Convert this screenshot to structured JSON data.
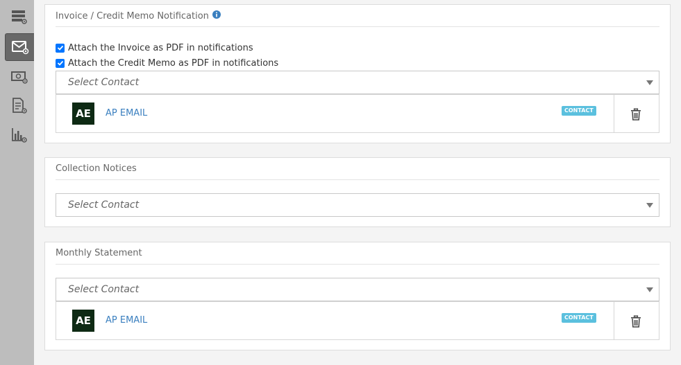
{
  "sidebar": {
    "items": [
      {
        "icon": "server-settings-icon",
        "active": false
      },
      {
        "icon": "envelope-settings-icon",
        "active": true
      },
      {
        "icon": "money-settings-icon",
        "active": false
      },
      {
        "icon": "document-settings-icon",
        "active": false
      },
      {
        "icon": "chart-settings-icon",
        "active": false
      }
    ]
  },
  "invoice_section": {
    "title": "Invoice / Credit Memo Notification",
    "checkbox_invoice_label": "Attach the Invoice as PDF in notifications",
    "checkbox_invoice_checked": true,
    "checkbox_credit_label": "Attach the Credit Memo as PDF in notifications",
    "checkbox_credit_checked": true,
    "select_placeholder": "Select Contact",
    "contact": {
      "initials": "AE",
      "name": "AP EMAIL",
      "badge": "CONTACT"
    }
  },
  "collection_section": {
    "title": "Collection Notices",
    "select_placeholder": "Select Contact"
  },
  "monthly_section": {
    "title": "Monthly Statement",
    "select_placeholder": "Select Contact",
    "contact": {
      "initials": "AE",
      "name": "AP EMAIL",
      "badge": "CONTACT"
    }
  },
  "colors": {
    "avatar_bg": "#0e2a14",
    "link": "#3a7fbf",
    "badge_bg": "#5bc0de",
    "checkbox": "#0075ff",
    "sidebar_bg": "#bdbdbd",
    "sidebar_active": "#686868"
  }
}
